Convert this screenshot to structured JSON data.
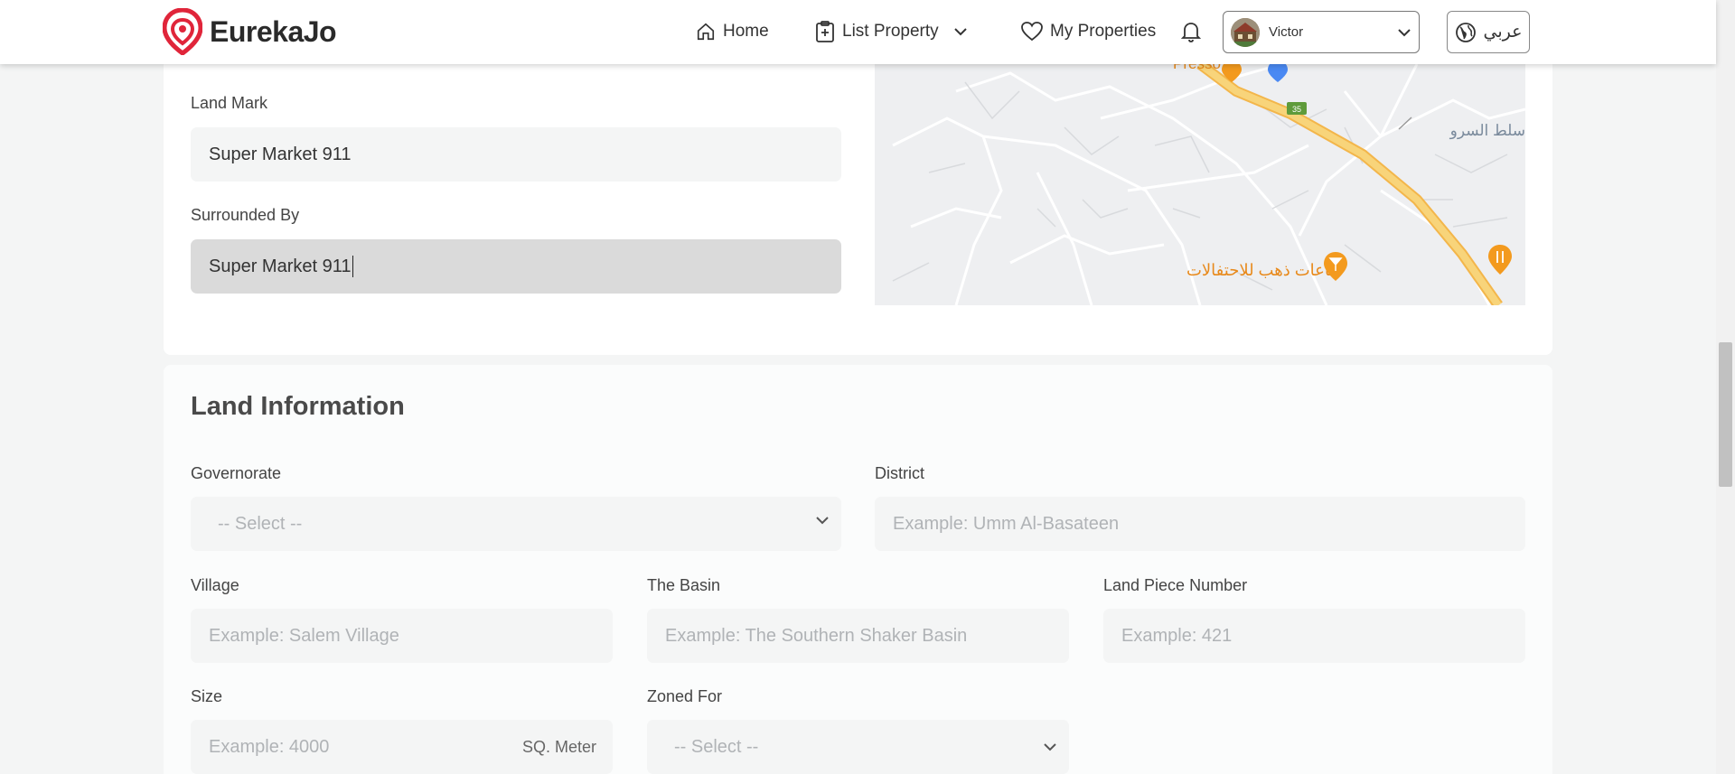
{
  "header": {
    "brand": "EurekaJo",
    "nav": {
      "home": "Home",
      "list_property": "List Property",
      "my_properties": "My Properties"
    },
    "user": {
      "name": "Victor"
    },
    "language_button": "عربي"
  },
  "location": {
    "landmark_label": "Land Mark",
    "landmark_value": "Super Market 911",
    "surrounded_label": "Surrounded By",
    "surrounded_value": "Super Market 911",
    "map_labels": {
      "place1": "Presso",
      "place2": "فاعات ذهب للاحتفالات",
      "place3": "سلط السرو",
      "road_badge": "35"
    }
  },
  "land_info": {
    "title": "Land Information",
    "governorate_label": "Governorate",
    "governorate_value": "-- Select --",
    "district_label": "District",
    "district_placeholder": "Example: Umm Al-Basateen",
    "village_label": "Village",
    "village_placeholder": "Example: Salem Village",
    "basin_label": "The Basin",
    "basin_placeholder": "Example: The Southern Shaker Basin",
    "piece_label": "Land Piece Number",
    "piece_placeholder": "Example: 421",
    "size_label": "Size",
    "size_placeholder": "Example: 4000",
    "size_unit": "SQ. Meter",
    "zoned_label": "Zoned For",
    "zoned_value": "-- Select --"
  },
  "colors": {
    "brand_red": "#e0253a",
    "road_yellow": "#f8c95a",
    "poi_orange": "#f39a1e"
  }
}
